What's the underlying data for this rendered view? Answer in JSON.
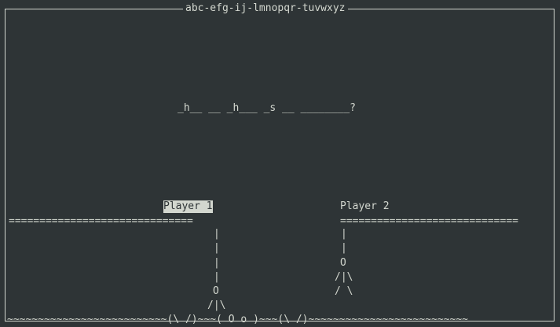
{
  "title": "abc-efg-ij-lmnopqr-tuvwxyz",
  "puzzle": "_h__ __ _h___ _s __ ________?",
  "players": [
    {
      "label": "Player 1",
      "active": true
    },
    {
      "label": "Player 2",
      "active": false
    }
  ],
  "planks": {
    "left": "==============================",
    "right": "============================="
  },
  "figure_left": [
    "|",
    "|",
    "|",
    "|",
    "O",
    "/|\\"
  ],
  "figure_right": [
    "|",
    "|",
    "O",
    "/|\\",
    "/ \\"
  ],
  "water": "~~~~~~~~~~~~~~~~~~~~~~~~~~(\\ /)~~~( O o )~~~(\\ /)~~~~~~~~~~~~~~~~~~~~~~~~~~"
}
